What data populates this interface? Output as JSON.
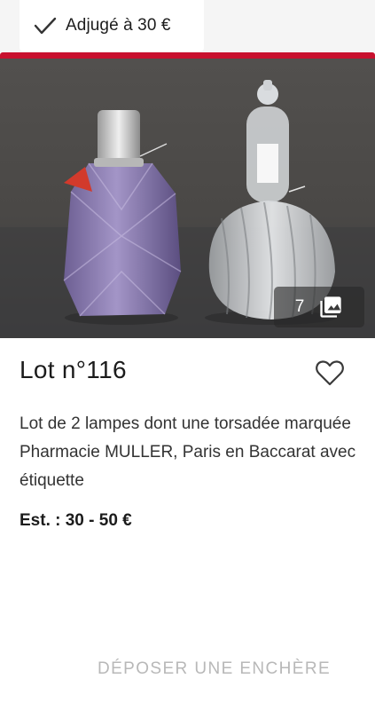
{
  "status": {
    "icon": "check-icon",
    "label": "Adjugé à 30 €"
  },
  "accent_color": "#c8102e",
  "photo": {
    "count": "7",
    "count_icon": "photo-library-icon"
  },
  "lot": {
    "title": "Lot n°116",
    "favorite_icon": "heart-outline-icon",
    "description": "Lot de 2 lampes dont une torsadée marquée Pharmacie MULLER, Paris en Baccarat avec étiquette",
    "estimate": "Est. : 30 - 50 €"
  },
  "actions": {
    "bid_label": "DÉPOSER UNE ENCHÈRE"
  }
}
